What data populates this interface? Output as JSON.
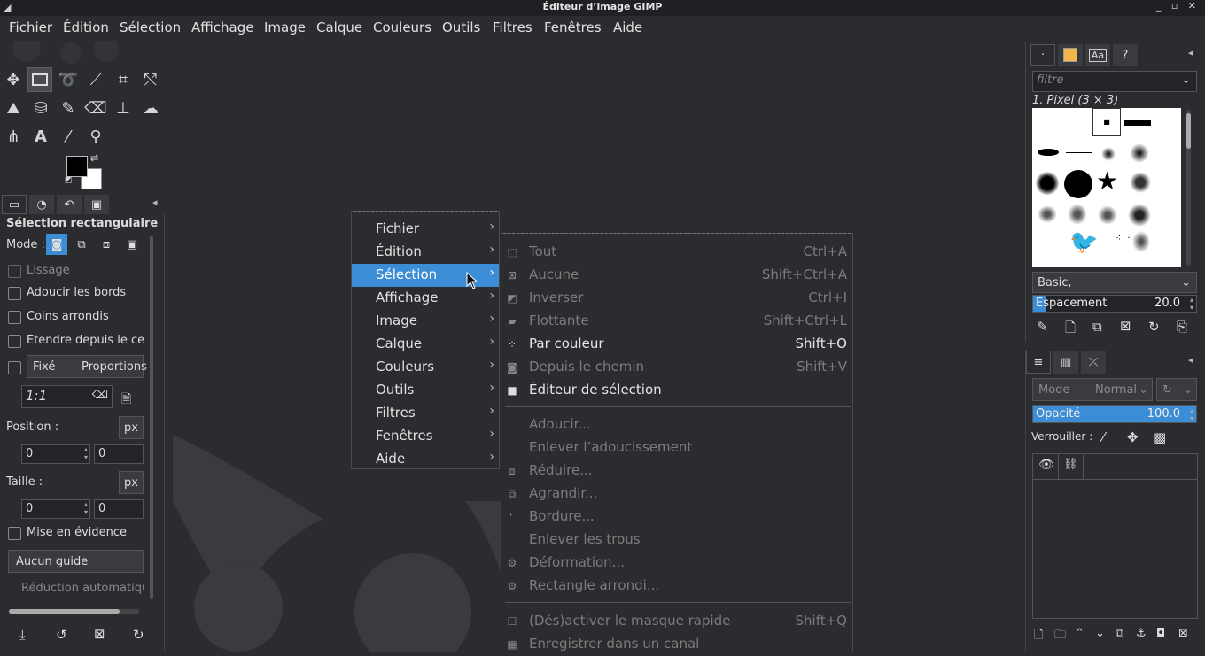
{
  "window": {
    "title": "Éditeur d’image GIMP",
    "controls": "_ ▫ ✕"
  },
  "menubar": [
    "Fichier",
    "Édition",
    "Sélection",
    "Affichage",
    "Image",
    "Calque",
    "Couleurs",
    "Outils",
    "Filtres",
    "Fenêtres",
    "Aide"
  ],
  "tool_options": {
    "title": "Sélection rectangulaire",
    "mode_label": "Mode :",
    "lissage": "Lissage",
    "adoucir": "Adoucir les bords",
    "coins": "Coins arrondis",
    "etendre": "Étendre depuis le ce",
    "fixe": "Fixé",
    "proportions": "Proportions",
    "ratio": "1:1",
    "position_label": "Position :",
    "unit": "px",
    "pos_x": "0",
    "pos_y": "0",
    "size_label": "Taille :",
    "size_w": "0",
    "size_h": "0",
    "highlight": "Mise en évidence",
    "guide": "Aucun guide",
    "auto_shrink": "Réduction automatiqu"
  },
  "context_menu": {
    "items": [
      "Fichier",
      "Édition",
      "Sélection",
      "Affichage",
      "Image",
      "Calque",
      "Couleurs",
      "Outils",
      "Filtres",
      "Fenêtres",
      "Aide"
    ],
    "highlighted": "Sélection"
  },
  "selection_menu": {
    "group1": [
      {
        "label": "Tout",
        "shortcut": "Ctrl+A",
        "enabled": false
      },
      {
        "label": "Aucune",
        "shortcut": "Shift+Ctrl+A",
        "enabled": false
      },
      {
        "label": "Inverser",
        "shortcut": "Ctrl+I",
        "enabled": false
      },
      {
        "label": "Flottante",
        "shortcut": "Shift+Ctrl+L",
        "enabled": false
      },
      {
        "label": "Par couleur",
        "shortcut": "Shift+O",
        "enabled": true
      },
      {
        "label": "Depuis le chemin",
        "shortcut": "Shift+V",
        "enabled": false
      },
      {
        "label": "Éditeur de sélection",
        "shortcut": "",
        "enabled": true
      }
    ],
    "group2": [
      {
        "label": "Adoucir...",
        "shortcut": ""
      },
      {
        "label": "Enlever l’adoucissement",
        "shortcut": ""
      },
      {
        "label": "Réduire...",
        "shortcut": ""
      },
      {
        "label": "Agrandir...",
        "shortcut": ""
      },
      {
        "label": "Bordure...",
        "shortcut": ""
      },
      {
        "label": "Enlever les trous",
        "shortcut": ""
      },
      {
        "label": "Déformation...",
        "shortcut": ""
      },
      {
        "label": "Rectangle arrondi...",
        "shortcut": ""
      }
    ],
    "group3": [
      {
        "label": "(Dés)activer le masque rapide",
        "shortcut": "Shift+Q"
      },
      {
        "label": "Enregistrer dans un canal",
        "shortcut": ""
      }
    ]
  },
  "brushes": {
    "filter_placeholder": "filtre",
    "current": "1. Pixel (3 × 3)",
    "tag": "Basic,",
    "spacing_label": "Espacement",
    "spacing_value": "20.0",
    "spacing_fraction": 0.08
  },
  "layers": {
    "mode_label": "Mode",
    "mode_value": "Normal",
    "opacity_label": "Opacité",
    "opacity_value": "100.0",
    "opacity_fraction": 1.0,
    "lock_label": "Verrouiller :"
  },
  "colors": {
    "accent": "#3b8dd6",
    "background": "#2b2c2f",
    "panel": "#3a3b3e"
  }
}
